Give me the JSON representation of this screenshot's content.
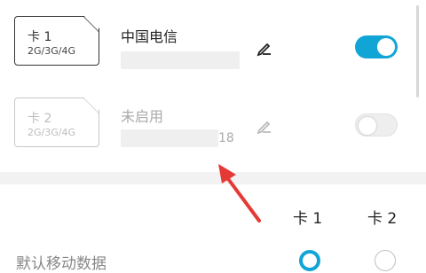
{
  "sim1": {
    "card_label": "卡 1",
    "network": "2G/3G/4G",
    "carrier": "中国电信",
    "enabled": true
  },
  "sim2": {
    "card_label": "卡 2",
    "network": "2G/3G/4G",
    "status": "未启用",
    "number_suffix": "18",
    "enabled": false
  },
  "default_data": {
    "columns": [
      "卡 1",
      "卡 2"
    ],
    "row_label": "默认移动数据",
    "selected": "卡 1"
  },
  "colors": {
    "accent": "#11a5d6",
    "arrow": "#e53935"
  },
  "icons": {
    "edit": "pencil-icon"
  }
}
